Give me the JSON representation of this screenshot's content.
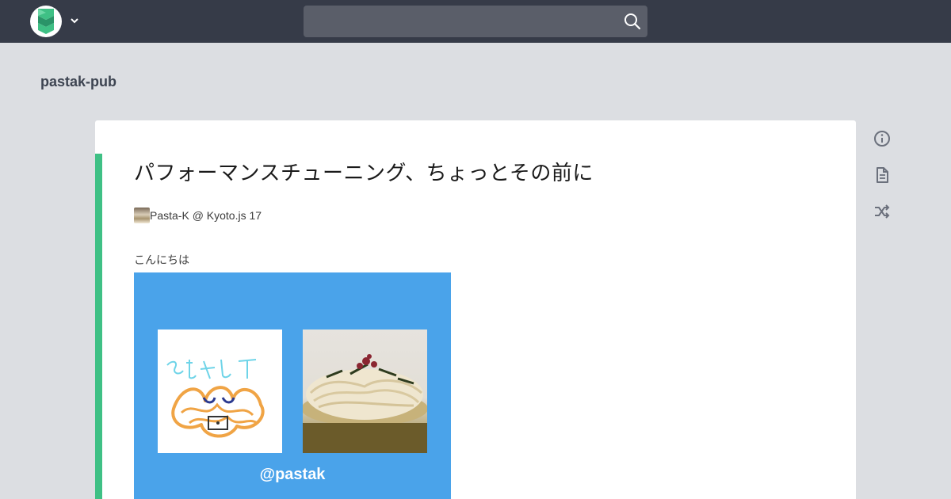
{
  "header": {
    "logo_icon": "scrapbox-logo-icon",
    "menu_icon": "chevron-down-icon",
    "search": {
      "value": "",
      "placeholder": "",
      "icon": "search-icon"
    }
  },
  "project": {
    "name": "pastak-pub"
  },
  "page": {
    "title": "パフォーマンスチューニング、ちょっとその前に",
    "author": "Pasta-K @ Kyoto.js 17",
    "greeting": "こんにちは",
    "slide": {
      "handle": "@pastak",
      "left_drawing_text": "そらキしT"
    }
  },
  "side_actions": [
    {
      "icon": "info-icon"
    },
    {
      "icon": "document-icon"
    },
    {
      "icon": "shuffle-icon"
    }
  ],
  "colors": {
    "topbar": "#363b48",
    "background": "#dcdee2",
    "accent": "#3fc085",
    "slide_bg": "#4aa3ea"
  }
}
